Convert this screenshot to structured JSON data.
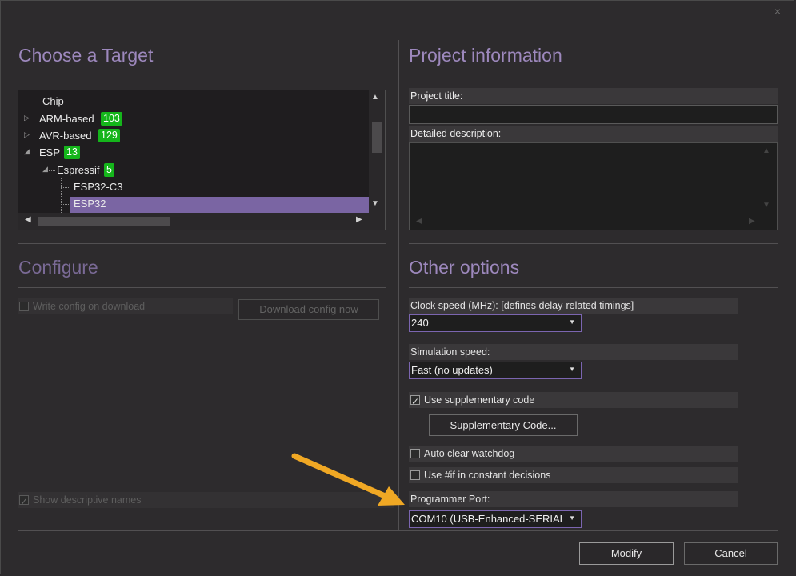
{
  "dialog": {
    "close_glyph": "×"
  },
  "target": {
    "title": "Choose a Target",
    "tree_header": "Chip",
    "items": [
      {
        "label": "ARM-based",
        "count": "103"
      },
      {
        "label": "AVR-based",
        "count": "129"
      },
      {
        "label": "ESP",
        "count": "13"
      },
      {
        "label": "Espressif",
        "count": "5"
      },
      {
        "label": "ESP32-C3"
      },
      {
        "label": "ESP32"
      }
    ],
    "selected": "ESP32"
  },
  "configure": {
    "title": "Configure",
    "write_config_label": "Write config on download",
    "download_button": "Download config now",
    "show_descriptive_label": "Show descriptive names"
  },
  "project": {
    "title": "Project information",
    "project_title_label": "Project title:",
    "project_title_value": "",
    "description_label": "Detailed description:",
    "description_value": ""
  },
  "options": {
    "title": "Other options",
    "clock_label": "Clock speed (MHz): [defines delay-related timings]",
    "clock_value": "240",
    "sim_label": "Simulation speed:",
    "sim_value": "Fast (no updates)",
    "supp_code_label": "Use supplementary code",
    "supp_code_checked": true,
    "supp_button": "Supplementary Code...",
    "watchdog_label": "Auto clear watchdog",
    "constant_label": "Use #if in constant decisions",
    "port_label": "Programmer Port:",
    "port_value": "COM10 (USB-Enhanced-SERIAL"
  },
  "footer": {
    "modify_button": "Modify",
    "cancel_button": "Cancel"
  },
  "colors": {
    "accent": "#9d88bd",
    "selection": "#7a65a3",
    "badge": "#15b51b",
    "arrow": "#f0a824",
    "background": "#2d2b2d"
  },
  "icons": [
    "close-icon",
    "expand-arrow-icon",
    "collapse-arrow-icon",
    "scroll-up-icon",
    "scroll-down-icon",
    "scroll-left-icon",
    "scroll-right-icon",
    "checkmark-icon",
    "dropdown-caret-icon",
    "annotation-arrow-icon"
  ]
}
